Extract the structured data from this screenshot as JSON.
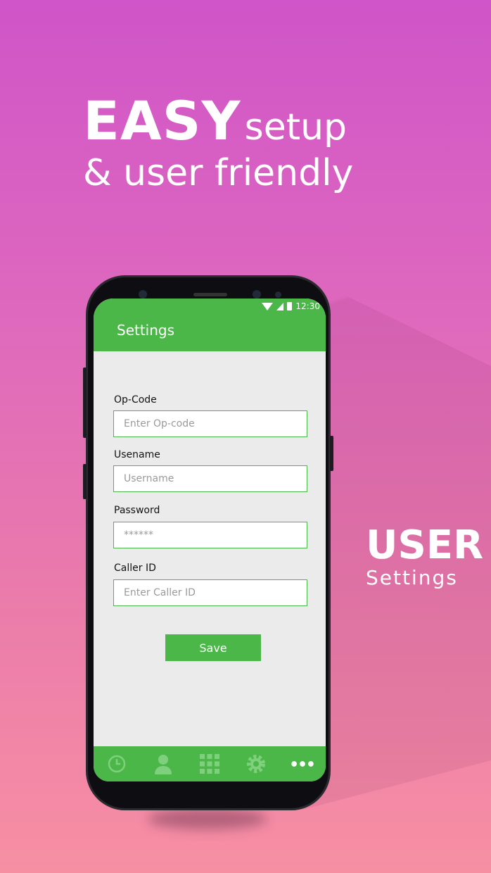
{
  "headline": {
    "bold": "EASY",
    "light": "setup",
    "line2": "& user friendly"
  },
  "side": {
    "big": "USER",
    "small": "Settings"
  },
  "status": {
    "time": "12:30"
  },
  "appbar": {
    "title": "Settings"
  },
  "form": {
    "opcode_label": "Op-Code",
    "opcode_placeholder": "Enter Op-code",
    "username_label": "Usename",
    "username_placeholder": "Username",
    "password_label": "Password",
    "password_placeholder": "******",
    "callerid_label": "Caller ID",
    "callerid_placeholder": "Enter Caller ID",
    "save_label": "Save"
  },
  "nav": [
    "clock-icon",
    "contact-icon",
    "dialpad-icon",
    "gear-icon",
    "more-icon"
  ],
  "colors": {
    "accent": "#4cb749",
    "nav_icon": "#7fd07c"
  }
}
